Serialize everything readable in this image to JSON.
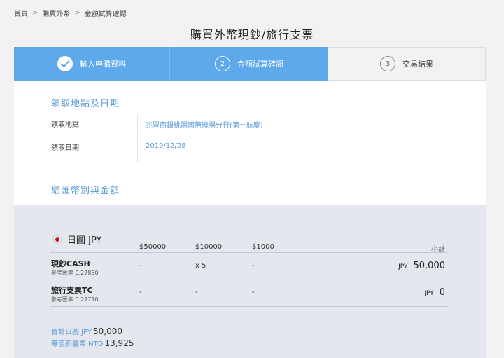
{
  "breadcrumb": {
    "items": [
      "首頁",
      "購買外幣",
      "金額試算確認"
    ],
    "separator": ">"
  },
  "page_title": "購買外幣現鈔/旅行支票",
  "steps": [
    {
      "number": "",
      "label": "輸入申購資料",
      "state": "done",
      "icon": "check-icon"
    },
    {
      "number": "2",
      "label": "金額試算確認",
      "state": "active"
    },
    {
      "number": "3",
      "label": "交易結果",
      "state": "pending"
    }
  ],
  "pickup": {
    "heading": "領取地點及日期",
    "location_label": "領取地點",
    "location_value": "兆豐商銀桃園國際機場分行(第一航廈)",
    "date_label": "領取日期",
    "date_value": "2019/12/28"
  },
  "settlement": {
    "heading": "結匯幣別與金額",
    "currency_name": "日圓 JPY",
    "flag_icon": "japan-flag-icon",
    "columns": [
      "$50000",
      "$10000",
      "$1000"
    ],
    "subtotal_header": "小計",
    "rows": [
      {
        "title": "現鈔CASH",
        "rate": "參考匯率 0.27850",
        "cells": [
          "-",
          "x 5",
          "-"
        ],
        "ccy": "JPY",
        "amount": "50,000"
      },
      {
        "title": "旅行支票TC",
        "rate": "參考匯率 0.27710",
        "cells": [
          "-",
          "-",
          "-"
        ],
        "ccy": "JPY",
        "amount": "0"
      }
    ],
    "total_label": "合計日圓 JPY",
    "total_value": "50,000",
    "ntd_label": "等值新臺幣 NTD",
    "ntd_value": "13,925"
  },
  "colors": {
    "accent": "#5ea8ec",
    "link_blue": "#5a9ad8",
    "flag_red": "#c8102e",
    "panel_gray": "#e4e7ed"
  }
}
